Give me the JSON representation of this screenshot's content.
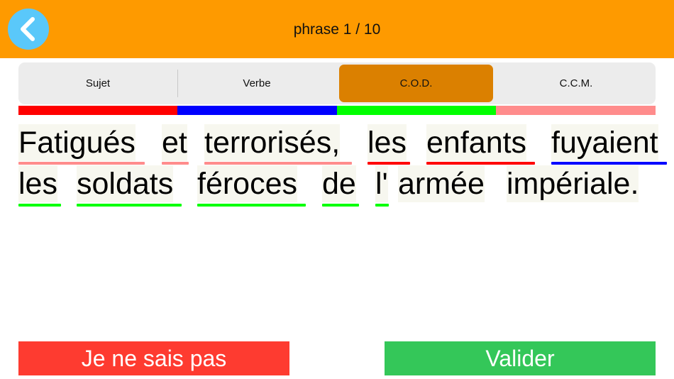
{
  "header": {
    "title": "phrase 1 / 10",
    "back_icon": "chevron-left-icon"
  },
  "categories": [
    {
      "label": "Sujet",
      "color": "#ff0000"
    },
    {
      "label": "Verbe",
      "color": "#0000ff"
    },
    {
      "label": "C.O.D.",
      "color": "#00ff00"
    },
    {
      "label": "C.C.M.",
      "color": "#ff8c8c"
    }
  ],
  "selected_category": "C.O.D.",
  "sentence": {
    "words": [
      {
        "text": "Fatigués",
        "category": "C.C.M."
      },
      {
        "text": "et",
        "category": "C.C.M."
      },
      {
        "text": "terrorisés,",
        "category": "C.C.M."
      },
      {
        "text": "les",
        "category": "Sujet"
      },
      {
        "text": "enfants",
        "category": "Sujet"
      },
      {
        "text": "fuyaient",
        "category": "Verbe"
      },
      {
        "text": "les",
        "category": "C.O.D."
      },
      {
        "text": "soldats",
        "category": "C.O.D."
      },
      {
        "text": "féroces",
        "category": "C.O.D."
      },
      {
        "text": "de",
        "category": "C.O.D."
      },
      {
        "text": "l'",
        "category": "C.O.D."
      },
      {
        "text": "armée",
        "category": ""
      },
      {
        "text": "impériale.",
        "category": ""
      }
    ]
  },
  "actions": {
    "dont_know": {
      "label": "Je ne sais pas",
      "color": "#fe3b30"
    },
    "validate": {
      "label": "Valider",
      "color": "#34c759"
    }
  }
}
